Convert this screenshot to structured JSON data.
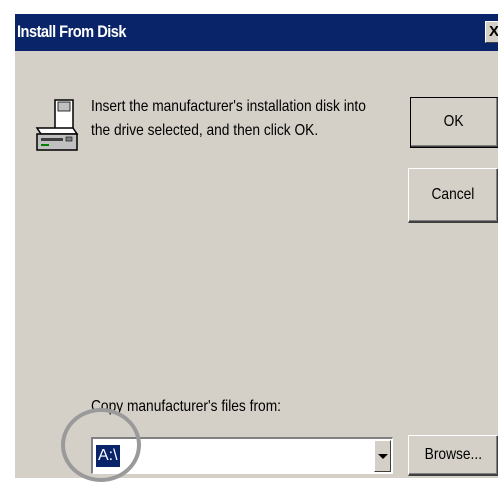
{
  "window": {
    "title": "Install From Disk",
    "close_label": "X"
  },
  "icons": {
    "disk": "floppy-disk-drive-icon",
    "close": "close-icon",
    "dropdown": "chevron-down-icon"
  },
  "message": "Insert the manufacturer's installation disk into the drive selected, and then click OK.",
  "buttons": {
    "ok": "OK",
    "cancel": "Cancel",
    "browse": "Browse..."
  },
  "copy_from": {
    "label": "Copy manufacturer's files from:",
    "value": "A:\\"
  },
  "colors": {
    "titlebar": "#0a246a",
    "dialog_face": "#d4d0c8",
    "selection": "#0a246a",
    "annotation_ring": "#9a9a9a"
  }
}
